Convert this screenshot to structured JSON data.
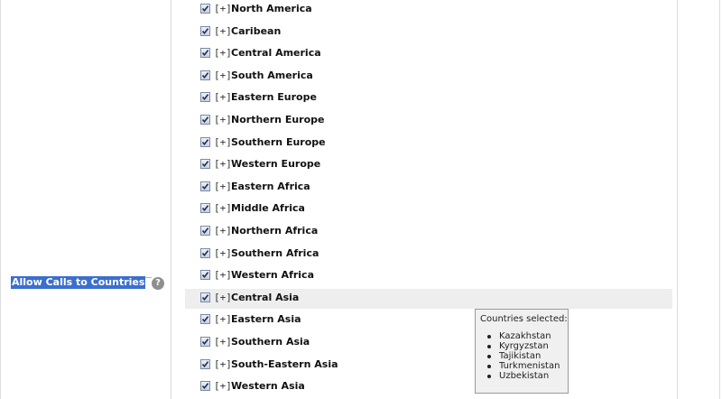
{
  "setting": {
    "label": "Allow Calls to Countries",
    "help_icon": "question-mark-icon"
  },
  "regions": {
    "expander": "[+]",
    "items": [
      {
        "name": "North America",
        "checked": true
      },
      {
        "name": "Caribean",
        "checked": true
      },
      {
        "name": "Central America",
        "checked": true
      },
      {
        "name": "South America",
        "checked": true
      },
      {
        "name": "Eastern Europe",
        "checked": true
      },
      {
        "name": "Northern Europe",
        "checked": true
      },
      {
        "name": "Southern Europe",
        "checked": true
      },
      {
        "name": "Western Europe",
        "checked": true
      },
      {
        "name": "Eastern Africa",
        "checked": true
      },
      {
        "name": "Middle Africa",
        "checked": true
      },
      {
        "name": "Northern Africa",
        "checked": true
      },
      {
        "name": "Southern Africa",
        "checked": true
      },
      {
        "name": "Western Africa",
        "checked": true
      },
      {
        "name": "Central Asia",
        "checked": true,
        "hovered": true
      },
      {
        "name": "Eastern Asia",
        "checked": true
      },
      {
        "name": "Southern Asia",
        "checked": true
      },
      {
        "name": "South-Eastern Asia",
        "checked": true
      },
      {
        "name": "Western Asia",
        "checked": true
      }
    ]
  },
  "tooltip": {
    "title": "Countries selected:",
    "countries": [
      "Kazakhstan",
      "Kyrgyzstan",
      "Tajikistan",
      "Turkmenistan",
      "Uzbekistan"
    ]
  },
  "colors": {
    "label_highlight": "#3b6fcf",
    "hover_row": "#eeeeee",
    "tooltip_bg": "#f0f0f0"
  }
}
